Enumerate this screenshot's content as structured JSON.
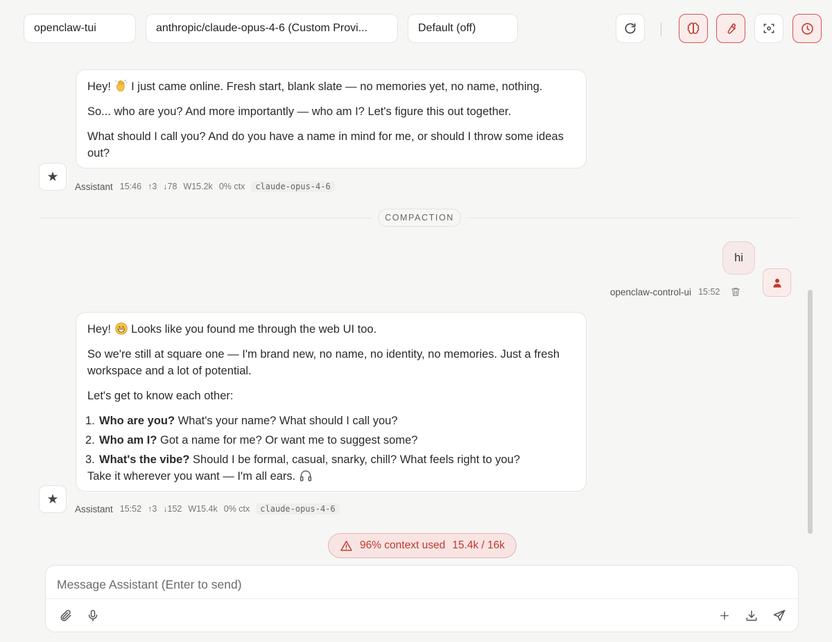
{
  "toolbar": {
    "agent_select": "openclaw-tui",
    "model_select": "anthropic/claude-opus-4-6 (Custom Provi...",
    "thinking_select": "Default (off)",
    "buttons": [
      {
        "name": "refresh-icon",
        "active": false
      },
      {
        "name": "brain-icon",
        "active": true
      },
      {
        "name": "wrench-icon",
        "active": true
      },
      {
        "name": "focus-icon",
        "active": false
      },
      {
        "name": "clock-icon",
        "active": true
      }
    ],
    "accent_color": "#d9534f"
  },
  "messages": [
    {
      "role": "assistant",
      "paragraphs": [
        {
          "before_emoji": "Hey!",
          "emoji": "waving-hand",
          "after_emoji": "I just came online. Fresh start, blank slate — no memories yet, no name, nothing."
        },
        "So... who are you? And more importantly — who am I? Let's figure this out together.",
        "What should I call you? And do you have a name in mind for me, or should I throw some ideas out?"
      ],
      "meta": {
        "author": "Assistant",
        "time": "15:46",
        "up": "↑3",
        "down": "↓78",
        "window": "W15.2k",
        "ctx": "0% ctx",
        "model": "claude-opus-4-6"
      }
    },
    {
      "role": "divider",
      "label": "COMPACTION"
    },
    {
      "role": "user",
      "text": "hi",
      "meta": {
        "author": "openclaw-control-ui",
        "time": "15:52"
      }
    },
    {
      "role": "assistant",
      "paragraphs": [
        {
          "before_emoji": "Hey!",
          "emoji": "grinning-face",
          "after_emoji": "Looks like you found me through the web UI too."
        },
        "So we're still at square one — I'm brand new, no name, no identity, no memories. Just a fresh workspace and a lot of potential.",
        "Let's get to know each other:"
      ],
      "list": [
        {
          "num": "1.",
          "bold": "Who are you?",
          "text": "What's your name? What should I call you?"
        },
        {
          "num": "2.",
          "bold": "Who am I?",
          "text": "Got a name for me? Or want me to suggest some?"
        },
        {
          "num": "3.",
          "bold": "What's the vibe?",
          "text": "Should I be formal, casual, snarky, chill? What feels right to you?"
        }
      ],
      "closing": "Take it wherever you want — I'm all ears.",
      "closing_emoji": "headphone",
      "meta": {
        "author": "Assistant",
        "time": "15:52",
        "up": "↑3",
        "down": "↓152",
        "window": "W15.4k",
        "ctx": "0% ctx",
        "model": "claude-opus-4-6"
      }
    }
  ],
  "context": {
    "label": "96% context used",
    "count": "15.4k / 16k",
    "fraction_used": 0.96,
    "color": "#c0392b"
  },
  "composer": {
    "placeholder": "Message Assistant (Enter to send)",
    "value": "",
    "left_icons": [
      "paperclip-icon",
      "microphone-icon"
    ],
    "right_icons": [
      "plus-icon",
      "download-icon",
      "send-icon"
    ]
  }
}
